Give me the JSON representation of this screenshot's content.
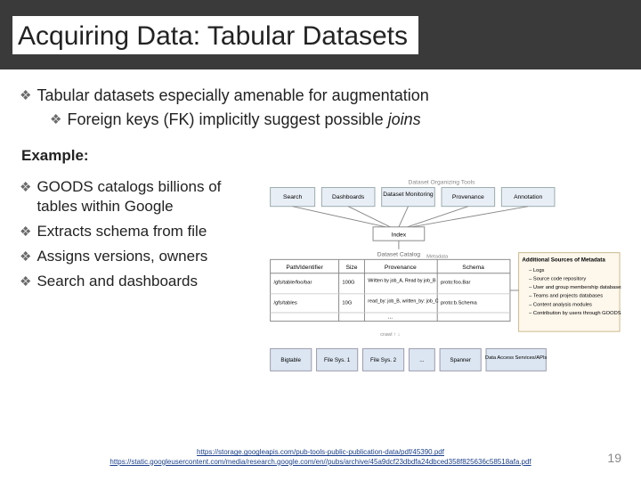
{
  "title": "Acquiring Data: Tabular Datasets",
  "bullets": {
    "b1": "Tabular datasets especially amenable for augmentation",
    "b1a_pre": "Foreign keys (FK) implicitly suggest possible ",
    "b1a_em": "joins"
  },
  "example_label": "Example:",
  "left": {
    "l1": "GOODS catalogs billions of tables within Google",
    "l2": "Extracts schema from file",
    "l3": "Assigns versions, owners",
    "l4": "Search and dashboards"
  },
  "diagram": {
    "top_label": "Dataset Organizing Tools",
    "tools": [
      "Search",
      "Dashboards",
      "Dataset Monitoring",
      "Provenance",
      "Annotation"
    ],
    "index": "Index",
    "catalog_label": "Dataset Catalog",
    "col_path": "Path/Identifier",
    "col_size": "Size",
    "col_prov": "Provenance",
    "col_schema": "Schema",
    "metadata_label": "Metadata",
    "row1_path": "/gfs/table/foo/bar",
    "row1_size": "100G",
    "row1_prov": "Written by job_A, Read by job_B",
    "row1_schema": "proto:foo.Bar",
    "row2_path": "/gfs/tables",
    "row2_size": "10G",
    "row2_prov": "read_by: job_B, written_by: job_C",
    "row2_schema": "proto:b.Schema",
    "addl_label": "Additional Sources of Metadata",
    "addl_items": [
      "Logs",
      "Source code repository",
      "User and group membership databases",
      "Teams and projects databases",
      "Content analysis modules",
      "Contribution by users through GOODS API"
    ],
    "storages": [
      "Bigtable",
      "File Sys. 1",
      "File Sys. 2",
      "...",
      "Spanner",
      "Data Access Services/APIs"
    ],
    "dots": "..."
  },
  "refs": {
    "r1": "https://storage.googleapis.com/pub-tools-public-publication-data/pdf/45390.pdf",
    "r2": "https://static.googleusercontent.com/media/research.google.com/en//pubs/archive/45a9dcf23dbdfa24dbced358f825636c58518afa.pdf"
  },
  "page": "19"
}
